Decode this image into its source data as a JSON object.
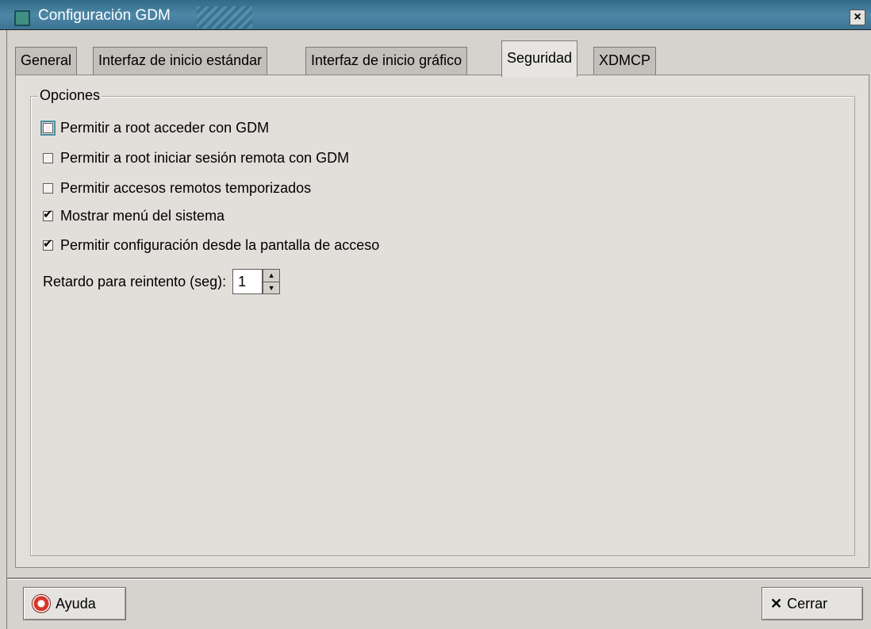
{
  "window": {
    "title": "Configuración GDM",
    "close_glyph": "×"
  },
  "tabs": [
    {
      "label": "General",
      "active": false
    },
    {
      "label": "Interfaz de inicio estándar",
      "active": false
    },
    {
      "label": "Interfaz de inicio gráfico",
      "active": false
    },
    {
      "label": "Seguridad",
      "active": true
    },
    {
      "label": "XDMCP",
      "active": false
    }
  ],
  "options": {
    "frame_label": "Opciones",
    "items": [
      {
        "label": "Permitir a root acceder con GDM",
        "checked": false
      },
      {
        "label": "Permitir a root iniciar sesión remota con GDM",
        "checked": false
      },
      {
        "label": "Permitir accesos remotos temporizados",
        "checked": false
      },
      {
        "label": "Mostrar menú del sistema",
        "checked": true
      },
      {
        "label": "Permitir configuración desde la pantalla de acceso",
        "checked": true
      }
    ],
    "retry": {
      "label": "Retardo para reintento (seg):",
      "value": "1"
    }
  },
  "buttons": {
    "help": {
      "label": "Ayuda",
      "icon": "help-lifebuoy-icon"
    },
    "close": {
      "label": "Cerrar",
      "icon": "close-x-icon"
    }
  },
  "colors": {
    "titlebar": "#3b7393",
    "background": "#d6d3ce",
    "tab_panel": "#e2dfdb"
  }
}
